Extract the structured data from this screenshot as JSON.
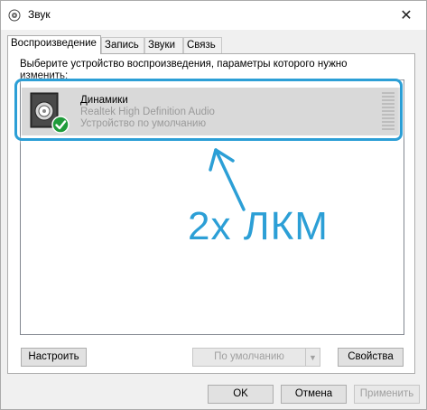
{
  "window": {
    "title": "Звук",
    "title_icon": "speaker-icon",
    "close_glyph": "✕"
  },
  "tabs": [
    {
      "label": "Воспроизведение",
      "active": true
    },
    {
      "label": "Запись",
      "active": false
    },
    {
      "label": "Звуки",
      "active": false
    },
    {
      "label": "Связь",
      "active": false
    }
  ],
  "playback": {
    "instruction": "Выберите устройство воспроизведения, параметры которого нужно изменить:",
    "devices": [
      {
        "name": "Динамики",
        "driver": "Realtek High Definition Audio",
        "status": "Устройство по умолчанию",
        "icon": "speaker-device-icon",
        "badge": "green-check-icon",
        "selected": true
      }
    ]
  },
  "annotation": {
    "text": "2x ЛКМ",
    "color": "#2c9fd6"
  },
  "buttons": {
    "configure": "Настроить",
    "set_default": "По умолчанию",
    "properties": "Свойства",
    "ok": "OK",
    "cancel": "Отмена",
    "apply": "Применить"
  },
  "colors": {
    "selection": "#d9d9d9",
    "accent": "#2c9fd6",
    "check_green": "#1f9b3a"
  }
}
